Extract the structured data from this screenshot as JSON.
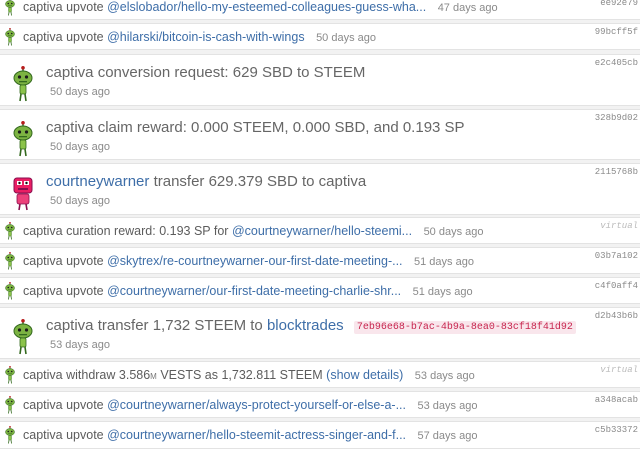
{
  "ops": [
    {
      "type": "small",
      "avatar": "green",
      "user": "captiva",
      "action": "upvote",
      "link": "@elslobador/hello-my-esteemed-colleagues-guess-wha...",
      "ago": "47 days ago",
      "txid": "ee92e79"
    },
    {
      "type": "small",
      "avatar": "green",
      "user": "captiva",
      "action": "upvote",
      "link": "@hilarski/bitcoin-is-cash-with-wings",
      "ago": "50 days ago",
      "txid": "99bcff5f"
    },
    {
      "type": "big",
      "avatar": "green",
      "text": "captiva conversion request: 629 SBD to STEEM",
      "ago": "50 days ago",
      "txid": "e2c405cb"
    },
    {
      "type": "big",
      "avatar": "green",
      "text": "captiva claim reward: 0.000 STEEM, 0.000 SBD, and 0.193 SP",
      "ago": "50 days ago",
      "txid": "328b9d02"
    },
    {
      "type": "big",
      "avatar": "pink",
      "user": "courtneywarner",
      "text": "transfer 629.379 SBD to captiva",
      "ago": "50 days ago",
      "txid": "2115768b"
    },
    {
      "type": "small",
      "avatar": "green",
      "user": "captiva",
      "action": "curation reward: 0.193 SP for",
      "link": "@courtneywarner/hello-steemi...",
      "ago": "50 days ago",
      "txid": "virtual"
    },
    {
      "type": "small",
      "avatar": "green",
      "user": "captiva",
      "action": "upvote",
      "link": "@skytrex/re-courtneywarner-our-first-date-meeting-...",
      "ago": "51 days ago",
      "txid": "03b7a102"
    },
    {
      "type": "small",
      "avatar": "green",
      "user": "captiva",
      "action": "upvote",
      "link": "@courtneywarner/our-first-date-meeting-charlie-shr...",
      "ago": "51 days ago",
      "txid": "c4f0aff4"
    },
    {
      "type": "big",
      "avatar": "green",
      "text": "captiva transfer 1,732 STEEM to",
      "link": "blocktrades",
      "memo": "7eb96e68-b7ac-4b9a-8ea0-83cf18f41d92",
      "ago": "53 days ago",
      "txid": "d2b43b6b"
    },
    {
      "type": "small",
      "avatar": "green",
      "user": "captiva",
      "action": "withdraw 3.586",
      "unit": "M",
      "action2": "VESTS as 1,732.811 STEEM",
      "link": "(show details)",
      "ago": "53 days ago",
      "txid": "virtual"
    },
    {
      "type": "small",
      "avatar": "green",
      "user": "captiva",
      "action": "upvote",
      "link": "@courtneywarner/always-protect-yourself-or-else-a-...",
      "ago": "53 days ago",
      "txid": "a348acab"
    },
    {
      "type": "small",
      "avatar": "green",
      "user": "captiva",
      "action": "upvote",
      "link": "@courtneywarner/hello-steemit-actress-singer-and-f...",
      "ago": "57 days ago",
      "txid": "c5b33372"
    }
  ]
}
